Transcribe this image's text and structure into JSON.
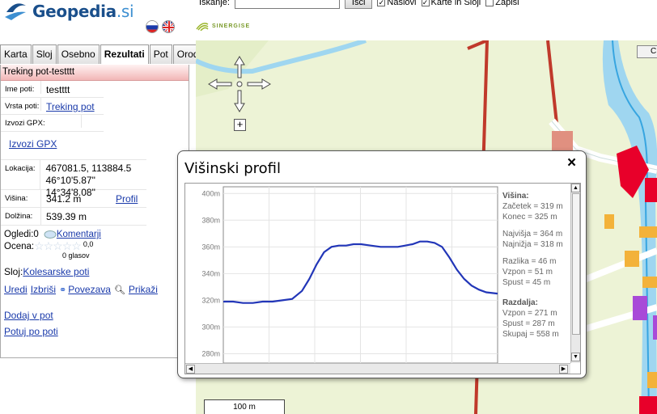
{
  "header": {
    "logo_text": "Geopedia",
    "logo_tld": ".si",
    "sponsor": "SINERGISE",
    "search_label": "Iskanje:",
    "search_value": "",
    "search_button": "Išči",
    "check_names": "Naslovi",
    "check_maps": "Karte in Sloji",
    "check_records": "Zapisi"
  },
  "tabs": [
    "Karta",
    "Sloj",
    "Osebno",
    "Rezultati",
    "Pot",
    "Orodja"
  ],
  "active_tab": "Rezultati",
  "panel": {
    "title": "Treking pot-testttt",
    "name_label": "Ime poti:",
    "name_value": "testttt",
    "type_label": "Vrsta poti:",
    "type_value": "Treking pot",
    "gpx_label": "Izvozi GPX:",
    "gpx_link": "Izvozi GPX",
    "location_label": "Lokacija:",
    "location_line1": "467081.5, 113884.5",
    "location_line2": "46°10'5.87\" 14°34'8.08\"",
    "height_label": "Višina:",
    "height_value": "341.2 m",
    "profile_link": "Profil",
    "length_label": "Dolžina:",
    "length_value": "539.39 m",
    "views_label": "Ogledi:0",
    "comments_link": "Komentarji",
    "rating_label": "Ocena:",
    "rating_value": "0,0",
    "votes": "0 glasov",
    "layer_label": "Sloj:",
    "layer_link": "Kolesarske poti",
    "edit_link": "Uredi",
    "delete_link": "Izbriši",
    "connection_link": "Povezava",
    "show_link": "Prikaži",
    "add_link": "Dodaj v pot",
    "travel_link": "Potuj po poti"
  },
  "map": {
    "scale": "100 m",
    "corner_button": "C"
  },
  "dialog": {
    "title": "Višinski profil",
    "close": "×",
    "stats": {
      "height_header": "Višina:",
      "start": "Začetek = 319 m",
      "end": "Konec = 325 m",
      "highest": "Najvišja = 364 m",
      "lowest": "Najnižja = 318 m",
      "diff": "Razlika = 46 m",
      "ascent": "Vzpon = 51 m",
      "descent": "Spust = 45 m",
      "distance_header": "Razdalja:",
      "dist_ascent": "Vzpon = 271 m",
      "dist_descent": "Spust = 287 m",
      "dist_total": "Skupaj = 558 m"
    }
  },
  "chart_data": {
    "type": "line",
    "title": "",
    "xlabel": "",
    "ylabel": "",
    "y_ticks": [
      "280m",
      "300m",
      "320m",
      "340m",
      "360m",
      "380m",
      "400m"
    ],
    "ylim": [
      273,
      405
    ],
    "grid": true,
    "series": [
      {
        "color": "#2236b8",
        "x": [
          0,
          20,
          40,
          60,
          80,
          100,
          120,
          140,
          160,
          175,
          190,
          205,
          220,
          235,
          250,
          265,
          280,
          300,
          320,
          340,
          355,
          370,
          385,
          400,
          415,
          430,
          445,
          460,
          475,
          490,
          505,
          520,
          535,
          558
        ],
        "values": [
          319,
          319,
          318,
          318,
          319,
          319,
          320,
          321,
          327,
          336,
          347,
          356,
          360,
          361,
          361,
          362,
          362,
          361,
          360,
          360,
          360,
          361,
          362,
          364,
          364,
          363,
          360,
          352,
          343,
          336,
          331,
          328,
          326,
          325
        ]
      }
    ]
  }
}
